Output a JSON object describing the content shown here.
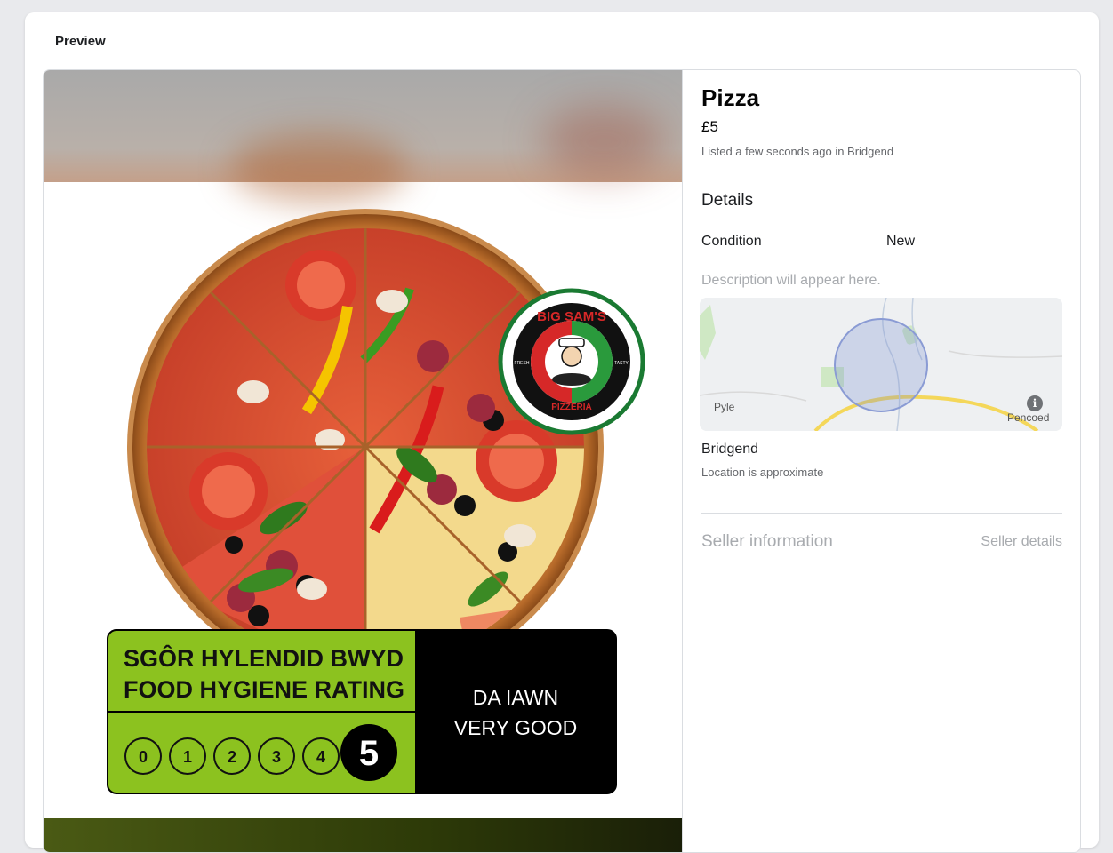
{
  "panel": {
    "title": "Preview"
  },
  "listing": {
    "title": "Pizza",
    "price": "£5",
    "meta": "Listed a few seconds ago in Bridgend",
    "details_heading": "Details",
    "condition_label": "Condition",
    "condition_value": "New",
    "description_placeholder": "Description will appear here.",
    "map": {
      "label_left": "Pyle",
      "label_right": "Pencoed",
      "info_icon": "info-icon"
    },
    "location_name": "Bridgend",
    "location_note": "Location is approximate",
    "seller_heading": "Seller information",
    "seller_link": "Seller details"
  },
  "image": {
    "logo": {
      "top": "BIG SAM'S",
      "bottom": "PIZZERIA",
      "left": "FRESH",
      "right": "TASTY"
    },
    "rating": {
      "line1": "SGÔR HYLENDID BWYD",
      "line2": "FOOD HYGIENE RATING",
      "scores": [
        "0",
        "1",
        "2",
        "3",
        "4"
      ],
      "selected": "5",
      "verdict_welsh": "DA IAWN",
      "verdict_english": "VERY GOOD"
    }
  },
  "colors": {
    "rating_green": "#8cc21f",
    "brand_red": "#d62828",
    "link_grey": "#a8abaf"
  }
}
